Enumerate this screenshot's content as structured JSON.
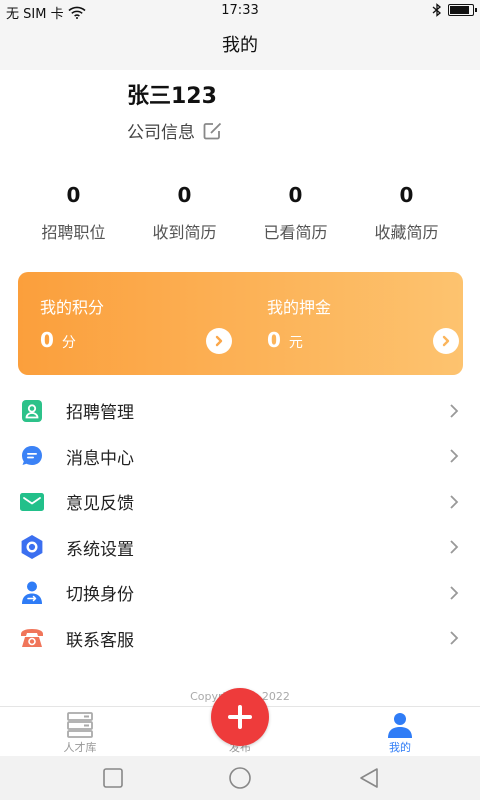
{
  "status_bar": {
    "carrier": "无 SIM 卡",
    "time": "17:33",
    "battery_level": 0.9
  },
  "header": {
    "title": "我的"
  },
  "profile": {
    "name": "张三123",
    "company_label": "公司信息"
  },
  "stats": [
    {
      "value": "0",
      "label": "招聘职位"
    },
    {
      "value": "0",
      "label": "收到简历"
    },
    {
      "value": "0",
      "label": "已看简历"
    },
    {
      "value": "0",
      "label": "收藏简历"
    }
  ],
  "card": {
    "points": {
      "title": "我的积分",
      "value": "0",
      "unit": "分"
    },
    "deposit": {
      "title": "我的押金",
      "value": "0",
      "unit": "元"
    },
    "colors": {
      "start": "#fb9f3c",
      "end": "#fdc36f"
    }
  },
  "menu": [
    {
      "label": "招聘管理",
      "icon": "recruit-icon",
      "color": "#2dc28a"
    },
    {
      "label": "消息中心",
      "icon": "message-icon",
      "color": "#3b82f6"
    },
    {
      "label": "意见反馈",
      "icon": "mail-icon",
      "color": "#22c08a"
    },
    {
      "label": "系统设置",
      "icon": "settings-icon",
      "color": "#3b6ff0"
    },
    {
      "label": "切换身份",
      "icon": "switch-user-icon",
      "color": "#2f7cf6"
    },
    {
      "label": "联系客服",
      "icon": "phone-icon",
      "color": "#f0755a"
    }
  ],
  "footer": {
    "copyright": "Copyright © 2022"
  },
  "tabs": [
    {
      "label": "人才库",
      "icon": "talent-pool-icon"
    },
    {
      "label": "发布",
      "icon": "plus-icon"
    },
    {
      "label": "我的",
      "icon": "user-icon"
    }
  ],
  "accent_color": "#2f7cf6",
  "publish_color": "#ee3b3b"
}
